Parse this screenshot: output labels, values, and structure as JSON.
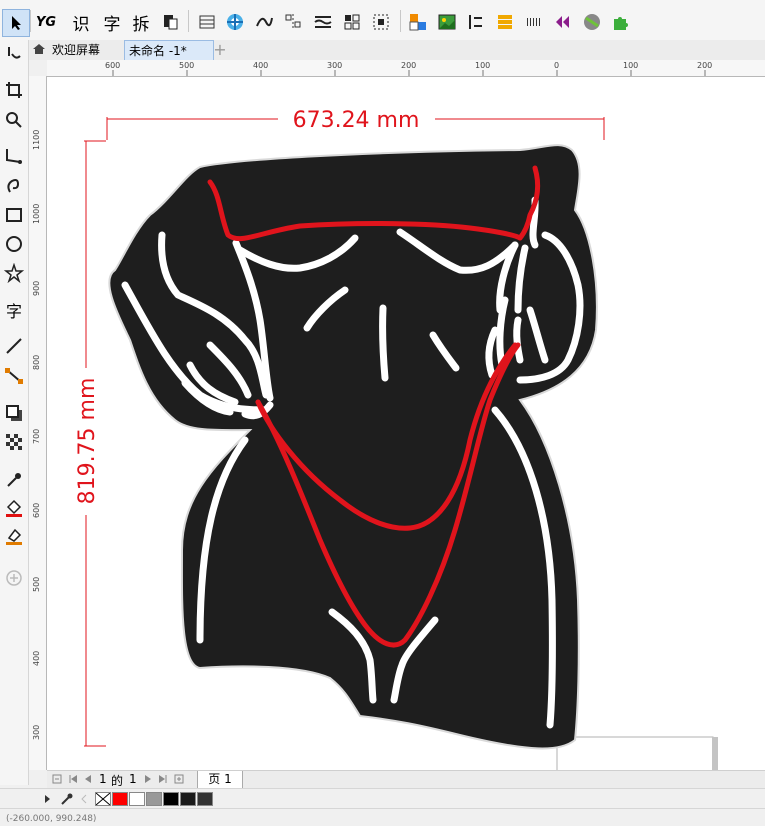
{
  "toolbar": {
    "yg_label": "YG",
    "shi_label": "识",
    "zi_label": "字",
    "chai_label": "拆"
  },
  "tabs": {
    "welcome_label": "欢迎屏幕",
    "document_label": "未命名 -1*",
    "new_tab_label": "+"
  },
  "toolbox": {
    "text_tool_label": "字"
  },
  "ruler": {
    "horizontal": [
      "600",
      "500",
      "400",
      "300",
      "200",
      "100",
      "0",
      "100",
      "200"
    ],
    "vertical": [
      "1100",
      "1000",
      "900",
      "800",
      "700",
      "600",
      "500",
      "400",
      "300"
    ]
  },
  "drawing": {
    "width_dimension": "673.24 mm",
    "height_dimension": "819.75 mm",
    "accent_color": "#e0141c",
    "shape_fill": "#1e1e1e",
    "line_color": "#ffffff"
  },
  "pagebar": {
    "page_current": "1",
    "page_of": "的",
    "page_total": "1",
    "page_tab_label": "页 1"
  },
  "palette": {
    "swatches": [
      "#ffffff",
      "#ff0000",
      "#ffffff",
      "#999999",
      "#000000",
      "#1a1a1a",
      "#333333"
    ]
  },
  "status": {
    "coords": "(-260.000, 990.248)"
  }
}
